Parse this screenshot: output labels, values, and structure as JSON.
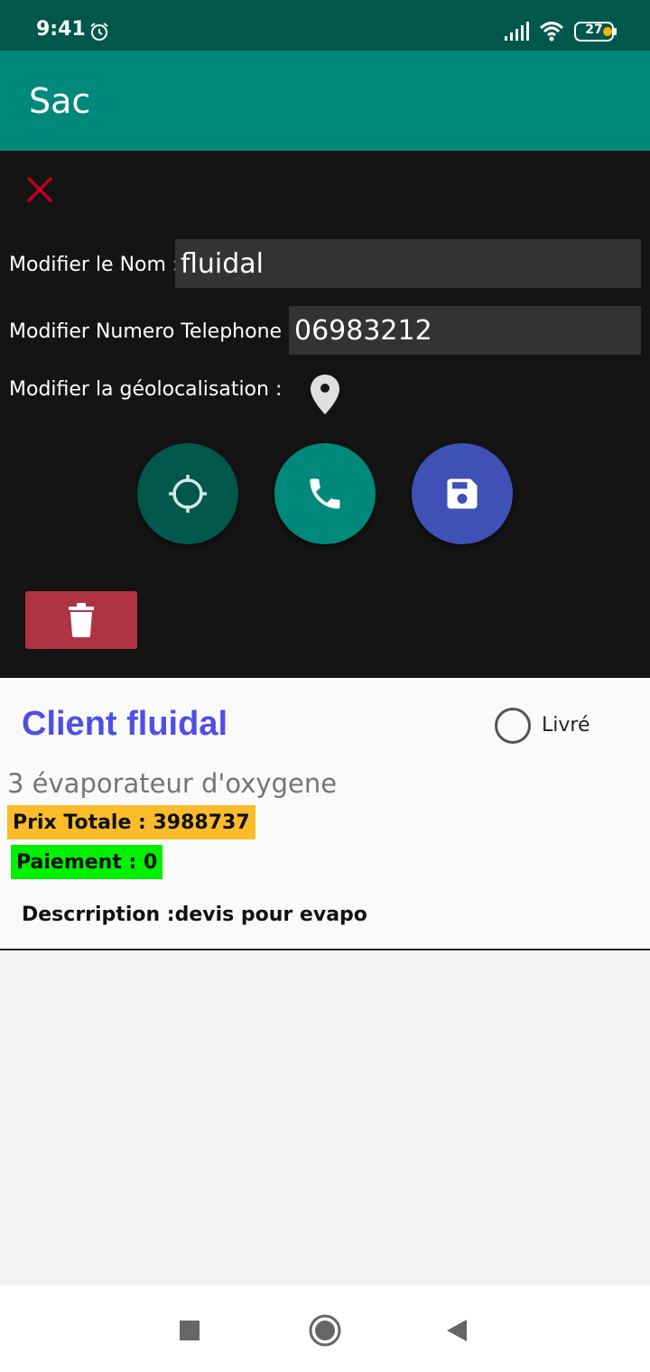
{
  "status_bar": {
    "time": "9:41",
    "battery": "27"
  },
  "app_bar": {
    "title": "Sac"
  },
  "form": {
    "name_label": "Modifier le Nom :",
    "name_value": "fluidal",
    "phone_label": "Modifier Numero Telephone :",
    "phone_value": "06983212",
    "geo_label": "Modifier la géolocalisation :"
  },
  "card": {
    "client_title": "Client fluidal",
    "delivered_label": "Livré",
    "delivered_checked": false,
    "product": "3 évaporateur d'oxygene",
    "total_price": "Prix Totale : 3988737",
    "payment": "Paiement  : 0",
    "description": "Descrription :devis pour evapo"
  },
  "colors": {
    "status_bar": "#00574b",
    "app_bar": "#00897b",
    "panel": "#141414",
    "locate_fab": "#00574b",
    "call_fab": "#00897b",
    "save_fab": "#3f51b5",
    "delete": "#b03344",
    "client_title": "#4f4fe6",
    "price_badge": "#fbbc2c",
    "payment_badge": "#00f000"
  },
  "icons": {
    "close": "close-icon",
    "location_pin": "location-pin-icon",
    "locate": "gps-fixed-icon",
    "call": "phone-icon",
    "save": "save-icon",
    "delete": "trash-icon"
  }
}
